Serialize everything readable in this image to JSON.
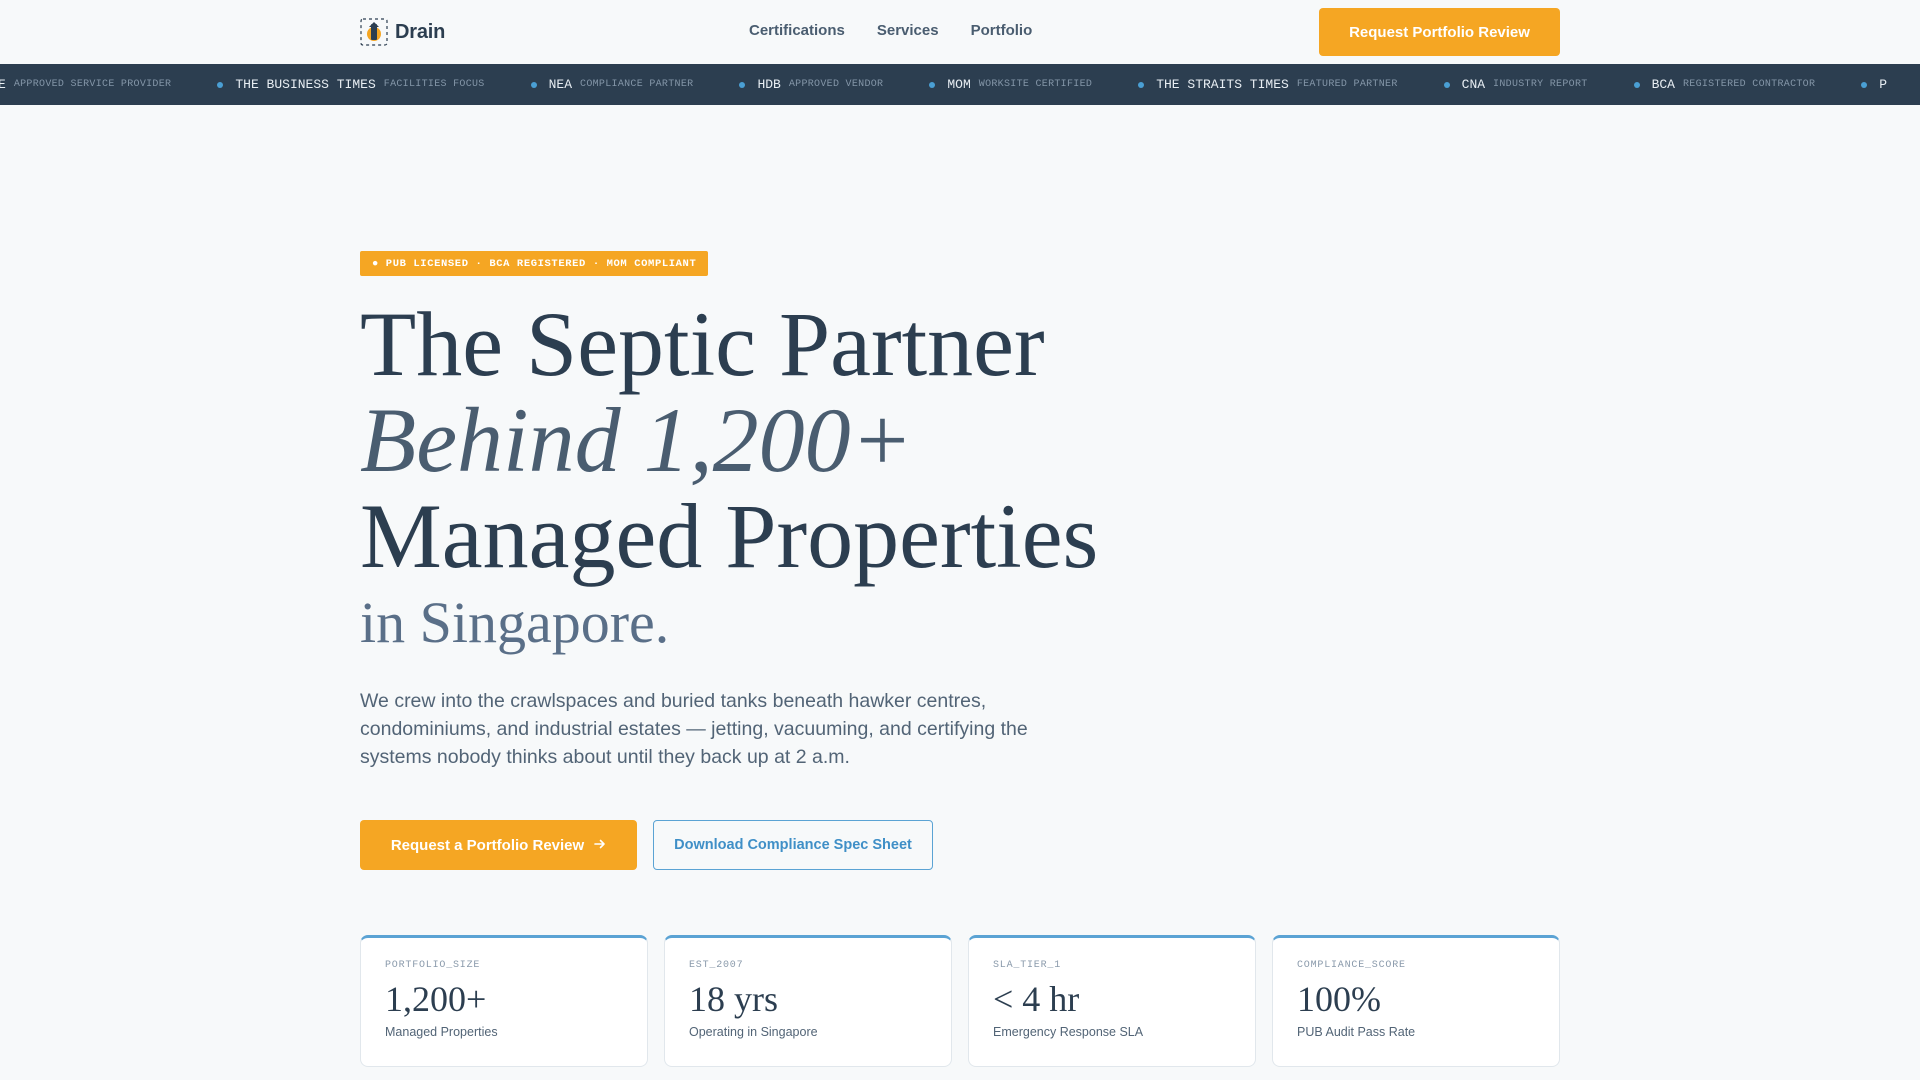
{
  "header": {
    "logo_text": "Drain",
    "nav": [
      {
        "label": "Certifications"
      },
      {
        "label": "Services"
      },
      {
        "label": "Portfolio"
      }
    ],
    "cta_label": "Request Portfolio Review"
  },
  "ticker": {
    "items": [
      {
        "name": "E",
        "desc": "APPROVED SERVICE PROVIDER"
      },
      {
        "name": "THE BUSINESS TIMES",
        "desc": "FACILITIES FOCUS"
      },
      {
        "name": "NEA",
        "desc": "COMPLIANCE PARTNER"
      },
      {
        "name": "HDB",
        "desc": "APPROVED VENDOR"
      },
      {
        "name": "MOM",
        "desc": "WORKSITE CERTIFIED"
      },
      {
        "name": "THE STRAITS TIMES",
        "desc": "FEATURED PARTNER"
      },
      {
        "name": "CNA",
        "desc": "INDUSTRY REPORT"
      },
      {
        "name": "BCA",
        "desc": "REGISTERED CONTRACTOR"
      },
      {
        "name": "P",
        "desc": ""
      }
    ]
  },
  "hero": {
    "badge": "● PUB LICENSED · BCA REGISTERED · MOM COMPLIANT",
    "title_line1": "The Septic Partner",
    "title_line2": "Behind 1,200+",
    "title_line3": "Managed Properties",
    "title_line4": "in Singapore.",
    "description": "We crew into the crawlspaces and buried tanks beneath hawker centres, condominiums, and industrial estates — jetting, vacuuming, and certifying the systems nobody thinks about until they back up at 2 a.m.",
    "primary_cta": "Request a Portfolio Review",
    "secondary_cta": "Download Compliance Spec Sheet"
  },
  "stats": [
    {
      "key": "PORTFOLIO_SIZE",
      "value": "1,200+",
      "label": "Managed Properties"
    },
    {
      "key": "EST_2007",
      "value": "18 yrs",
      "label": "Operating in Singapore"
    },
    {
      "key": "SLA_TIER_1",
      "value": "< 4 hr",
      "label": "Emergency Response SLA"
    },
    {
      "key": "COMPLIANCE_SCORE",
      "value": "100%",
      "label": "PUB Audit Pass Rate"
    }
  ],
  "colors": {
    "accent": "#f5a623",
    "navy": "#2c3e50",
    "blue": "#5ba3d4",
    "background": "#f7f9fa"
  }
}
